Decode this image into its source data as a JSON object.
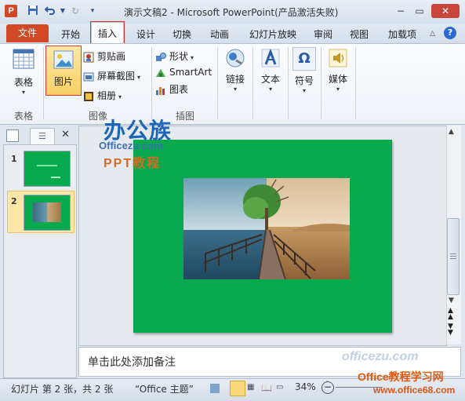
{
  "window": {
    "title": "演示文稿2 - Microsoft PowerPoint(产品激活失败)",
    "app_icon_letter": "P"
  },
  "tabs": [
    "文件",
    "开始",
    "插入",
    "设计",
    "切换",
    "动画",
    "幻灯片放映",
    "审阅",
    "视图",
    "加载项"
  ],
  "ribbon": {
    "groups": {
      "tables": "表格",
      "images": "图像",
      "illustrations": "插图"
    },
    "buttons": {
      "table": "表格",
      "picture": "图片",
      "clipart": "剪贴画",
      "screenshot": "屏幕截图",
      "album": "相册",
      "shapes": "形状",
      "smartart": "SmartArt",
      "chart": "图表",
      "links": "链接",
      "text": "文本",
      "symbols": "符号",
      "media": "媒体"
    }
  },
  "slides_panel": {
    "slide_numbers": [
      "1",
      "2"
    ]
  },
  "notes_placeholder": "单击此处添加备注",
  "status": {
    "slide_info": "幻灯片 第 2 张，共 2 张",
    "theme": "“Office 主题”",
    "zoom": "34%"
  },
  "watermarks": {
    "top_logo": "办公族",
    "top_sub": "Officezu.com",
    "top_tag": "PPT教程",
    "bottom_brand": "Office教程学习网",
    "bottom_url": "www.office68.com",
    "bottom_faint": "officezu.com"
  },
  "colors": {
    "accent_file_tab": "#d24a25",
    "slide_bg": "#07a94e",
    "highlight_border": "#d83a3a"
  }
}
